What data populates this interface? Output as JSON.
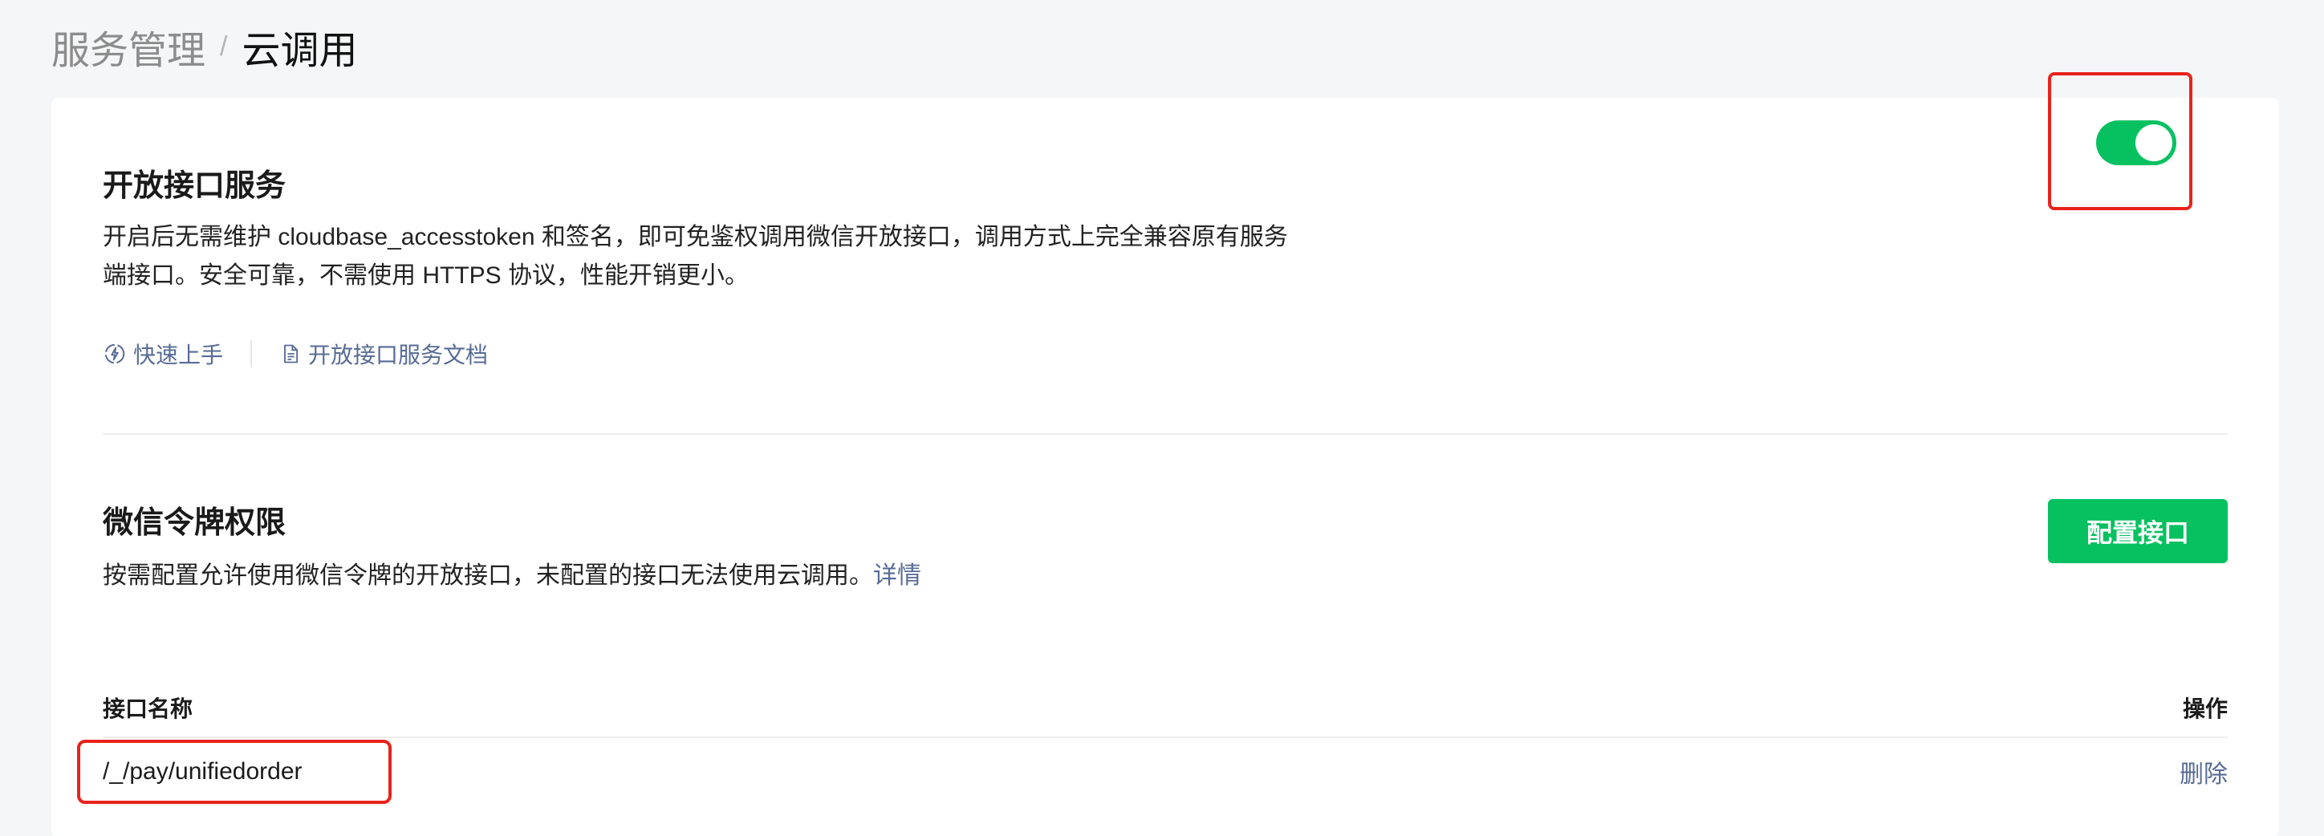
{
  "breadcrumb": {
    "parent": "服务管理",
    "separator": "/",
    "current": "云调用"
  },
  "open_service": {
    "title": "开放接口服务",
    "description": "开启后无需维护 cloudbase_accesstoken 和签名，即可免鉴权调用微信开放接口，调用方式上完全兼容原有服务端接口。安全可靠，不需使用 HTTPS 协议，性能开销更小。",
    "enabled": true,
    "links": {
      "quick_start": "快速上手",
      "docs": "开放接口服务文档"
    }
  },
  "permissions": {
    "title": "微信令牌权限",
    "description": "按需配置允许使用微信令牌的开放接口，未配置的接口无法使用云调用。",
    "detail_link": "详情",
    "config_button": "配置接口"
  },
  "table": {
    "columns": {
      "name": "接口名称",
      "action": "操作"
    },
    "rows": [
      {
        "name": "/_/pay/unifiedorder",
        "action": "删除"
      }
    ]
  },
  "colors": {
    "accent_green": "#07c160",
    "link_blue": "#576b95",
    "highlight_red": "#e8231c"
  },
  "icons": {
    "quick_start": "lightning-circle-icon",
    "docs": "document-icon"
  }
}
